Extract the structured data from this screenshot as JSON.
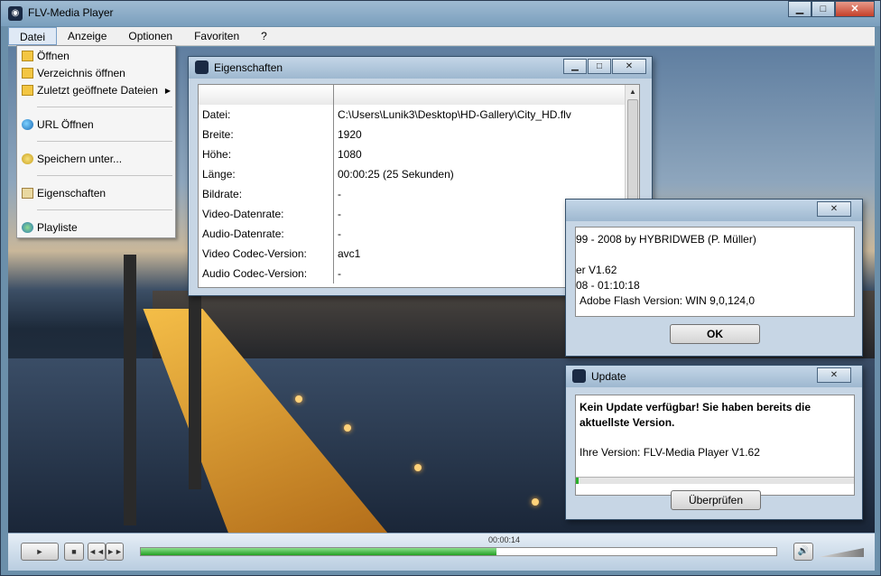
{
  "window": {
    "title": "FLV-Media Player"
  },
  "menubar": [
    {
      "label": "Datei",
      "active": true
    },
    {
      "label": "Anzeige"
    },
    {
      "label": "Optionen"
    },
    {
      "label": "Favoriten"
    },
    {
      "label": "?"
    }
  ],
  "datei_menu": [
    {
      "label": "Öffnen",
      "icon": "folder-icon"
    },
    {
      "label": "Verzeichnis öffnen",
      "icon": "folder-icon"
    },
    {
      "label": "Zuletzt geöffnete Dateien",
      "icon": "folder-icon",
      "submenu": true
    },
    {
      "label": "URL Öffnen",
      "icon": "globe-icon"
    },
    {
      "label": "Speichern unter...",
      "icon": "save-icon"
    },
    {
      "label": "Eigenschaften",
      "icon": "properties-icon"
    },
    {
      "label": "Playliste",
      "icon": "playlist-icon"
    }
  ],
  "properties_dialog": {
    "title": "Eigenschaften",
    "rows": [
      {
        "key": "Datei:",
        "value": "C:\\Users\\Lunik3\\Desktop\\HD-Gallery\\City_HD.flv"
      },
      {
        "key": "Breite:",
        "value": "1920"
      },
      {
        "key": "Höhe:",
        "value": "1080"
      },
      {
        "key": "Länge:",
        "value": "00:00:25 (25 Sekunden)"
      },
      {
        "key": "Bildrate:",
        "value": "-"
      },
      {
        "key": "Video-Datenrate:",
        "value": "-"
      },
      {
        "key": "Audio-Datenrate:",
        "value": "-"
      },
      {
        "key": "Video Codec-Version:",
        "value": "avc1"
      },
      {
        "key": "Audio Codec-Version:",
        "value": "-"
      }
    ]
  },
  "about_dialog": {
    "line1": "99 - 2008 by HYBRIDWEB (P. Müller)",
    "line2": "er V1.62",
    "line3": "08 - 01:10:18",
    "line4": "Adobe Flash Version: WIN 9,0,124,0",
    "ok_label": "OK"
  },
  "update_dialog": {
    "title": "Update",
    "message": "Kein Update verfügbar! Sie haben bereits die aktuellste Version.",
    "version": "Ihre Version: FLV-Media Player V1.62",
    "check_label": "Überprüfen",
    "progress": 0.01
  },
  "controls": {
    "time": "00:00:14",
    "progress": 0.56,
    "play": "►",
    "stop": "■",
    "prev": "◄◄",
    "next": "►►",
    "volume_icon": "speaker-icon"
  }
}
